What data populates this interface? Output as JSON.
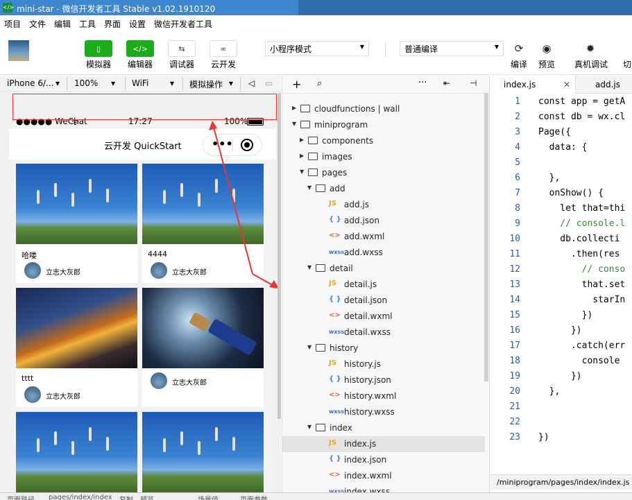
{
  "window": {
    "title": "mini-star - 微信开发者工具 Stable v1.02.1910120",
    "app_icon": "</>"
  },
  "menu": [
    "项目",
    "文件",
    "编辑",
    "工具",
    "界面",
    "设置",
    "微信开发者工具"
  ],
  "toolbar": {
    "simulator": "模拟器",
    "editor": "编辑器",
    "debugger": "调试器",
    "cloud": "云开发",
    "mode": "小程序模式",
    "compile": "普通编译",
    "compile_btn": "编译",
    "preview_btn": "预览",
    "remote_debug": "真机调试",
    "switch": "切"
  },
  "device_bar": {
    "device": "iPhone 6/...",
    "zoom": "100%",
    "network": "WiFi",
    "sim_ops": "模拟操作"
  },
  "phone": {
    "carrier": "●●●●● WeChat",
    "time": "17:27",
    "battery": "100%",
    "nav_title": "云开发 QuickStart",
    "cards": [
      {
        "caption": "哈喽",
        "user": "立志大灰郎"
      },
      {
        "caption": "4444",
        "user": "立志大灰郎"
      },
      {
        "caption": "tttt",
        "user": "立志大灰郎"
      },
      {
        "caption": "",
        "user": "立志大灰郎"
      }
    ]
  },
  "tree": [
    {
      "label": "cloudfunctions | wall",
      "type": "folder",
      "level": 0,
      "open": false
    },
    {
      "label": "miniprogram",
      "type": "folder",
      "level": 0,
      "open": true
    },
    {
      "label": "components",
      "type": "folder",
      "level": 1,
      "open": false
    },
    {
      "label": "images",
      "type": "folder",
      "level": 1,
      "open": false
    },
    {
      "label": "pages",
      "type": "folder",
      "level": 1,
      "open": true
    },
    {
      "label": "add",
      "type": "folder",
      "level": 2,
      "open": true
    },
    {
      "label": "add.js",
      "type": "js",
      "level": 3
    },
    {
      "label": "add.json",
      "type": "json",
      "level": 3
    },
    {
      "label": "add.wxml",
      "type": "wxml",
      "level": 3
    },
    {
      "label": "add.wxss",
      "type": "wxss",
      "level": 3
    },
    {
      "label": "detail",
      "type": "folder",
      "level": 2,
      "open": true
    },
    {
      "label": "detail.js",
      "type": "js",
      "level": 3
    },
    {
      "label": "detail.json",
      "type": "json",
      "level": 3
    },
    {
      "label": "detail.wxml",
      "type": "wxml",
      "level": 3
    },
    {
      "label": "detail.wxss",
      "type": "wxss",
      "level": 3
    },
    {
      "label": "history",
      "type": "folder",
      "level": 2,
      "open": true
    },
    {
      "label": "history.js",
      "type": "js",
      "level": 3
    },
    {
      "label": "history.json",
      "type": "json",
      "level": 3
    },
    {
      "label": "history.wxml",
      "type": "wxml",
      "level": 3
    },
    {
      "label": "history.wxss",
      "type": "wxss",
      "level": 3
    },
    {
      "label": "index",
      "type": "folder",
      "level": 2,
      "open": true
    },
    {
      "label": "index.js",
      "type": "js",
      "level": 3,
      "selected": true
    },
    {
      "label": "index.json",
      "type": "json",
      "level": 3
    },
    {
      "label": "index.wxml",
      "type": "wxml",
      "level": 3
    },
    {
      "label": "index.wxss",
      "type": "wxss",
      "level": 3
    }
  ],
  "editor": {
    "tabs": [
      {
        "label": "index.js",
        "active": true,
        "close": "✕"
      },
      {
        "label": "add.js",
        "active": false
      }
    ],
    "lines": [
      {
        "n": "1",
        "code": "const app = getA"
      },
      {
        "n": "2",
        "code": "const db = wx.cl"
      },
      {
        "n": "3",
        "code": "Page({"
      },
      {
        "n": "4",
        "code": "  data: {"
      },
      {
        "n": "5",
        "code": ""
      },
      {
        "n": "6",
        "code": "  },"
      },
      {
        "n": "7",
        "code": "  onShow() {"
      },
      {
        "n": "8",
        "code": "    let that=thi"
      },
      {
        "n": "9",
        "code": "    // console.l"
      },
      {
        "n": "10",
        "code": "    db.collecti"
      },
      {
        "n": "11",
        "code": "      .then(res"
      },
      {
        "n": "12",
        "code": "        // conso"
      },
      {
        "n": "13",
        "code": "        that.set"
      },
      {
        "n": "14",
        "code": "          starIn"
      },
      {
        "n": "15",
        "code": "        })"
      },
      {
        "n": "16",
        "code": "      })"
      },
      {
        "n": "17",
        "code": "      .catch(err"
      },
      {
        "n": "18",
        "code": "        console"
      },
      {
        "n": "19",
        "code": "      })"
      },
      {
        "n": "20",
        "code": "  },"
      },
      {
        "n": "21",
        "code": ""
      },
      {
        "n": "22",
        "code": ""
      },
      {
        "n": "23",
        "code": "})"
      }
    ],
    "path": "/miniprogram/pages/index/index.js"
  },
  "bottom": {
    "page_path": "页面路径",
    "path_value": "pages/index/index",
    "copy": "复制",
    "preview": "预览",
    "scene": "场景值",
    "params": "页面参数"
  }
}
